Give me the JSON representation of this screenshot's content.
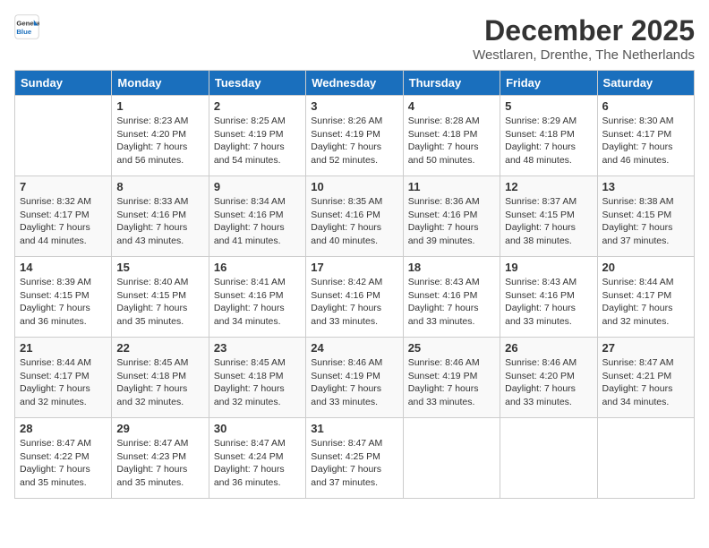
{
  "logo": {
    "general": "General",
    "blue": "Blue"
  },
  "header": {
    "month": "December 2025",
    "location": "Westlaren, Drenthe, The Netherlands"
  },
  "days_of_week": [
    "Sunday",
    "Monday",
    "Tuesday",
    "Wednesday",
    "Thursday",
    "Friday",
    "Saturday"
  ],
  "weeks": [
    [
      {
        "day": "",
        "sunrise": "",
        "sunset": "",
        "daylight": ""
      },
      {
        "day": "1",
        "sunrise": "Sunrise: 8:23 AM",
        "sunset": "Sunset: 4:20 PM",
        "daylight": "Daylight: 7 hours and 56 minutes."
      },
      {
        "day": "2",
        "sunrise": "Sunrise: 8:25 AM",
        "sunset": "Sunset: 4:19 PM",
        "daylight": "Daylight: 7 hours and 54 minutes."
      },
      {
        "day": "3",
        "sunrise": "Sunrise: 8:26 AM",
        "sunset": "Sunset: 4:19 PM",
        "daylight": "Daylight: 7 hours and 52 minutes."
      },
      {
        "day": "4",
        "sunrise": "Sunrise: 8:28 AM",
        "sunset": "Sunset: 4:18 PM",
        "daylight": "Daylight: 7 hours and 50 minutes."
      },
      {
        "day": "5",
        "sunrise": "Sunrise: 8:29 AM",
        "sunset": "Sunset: 4:18 PM",
        "daylight": "Daylight: 7 hours and 48 minutes."
      },
      {
        "day": "6",
        "sunrise": "Sunrise: 8:30 AM",
        "sunset": "Sunset: 4:17 PM",
        "daylight": "Daylight: 7 hours and 46 minutes."
      }
    ],
    [
      {
        "day": "7",
        "sunrise": "Sunrise: 8:32 AM",
        "sunset": "Sunset: 4:17 PM",
        "daylight": "Daylight: 7 hours and 44 minutes."
      },
      {
        "day": "8",
        "sunrise": "Sunrise: 8:33 AM",
        "sunset": "Sunset: 4:16 PM",
        "daylight": "Daylight: 7 hours and 43 minutes."
      },
      {
        "day": "9",
        "sunrise": "Sunrise: 8:34 AM",
        "sunset": "Sunset: 4:16 PM",
        "daylight": "Daylight: 7 hours and 41 minutes."
      },
      {
        "day": "10",
        "sunrise": "Sunrise: 8:35 AM",
        "sunset": "Sunset: 4:16 PM",
        "daylight": "Daylight: 7 hours and 40 minutes."
      },
      {
        "day": "11",
        "sunrise": "Sunrise: 8:36 AM",
        "sunset": "Sunset: 4:16 PM",
        "daylight": "Daylight: 7 hours and 39 minutes."
      },
      {
        "day": "12",
        "sunrise": "Sunrise: 8:37 AM",
        "sunset": "Sunset: 4:15 PM",
        "daylight": "Daylight: 7 hours and 38 minutes."
      },
      {
        "day": "13",
        "sunrise": "Sunrise: 8:38 AM",
        "sunset": "Sunset: 4:15 PM",
        "daylight": "Daylight: 7 hours and 37 minutes."
      }
    ],
    [
      {
        "day": "14",
        "sunrise": "Sunrise: 8:39 AM",
        "sunset": "Sunset: 4:15 PM",
        "daylight": "Daylight: 7 hours and 36 minutes."
      },
      {
        "day": "15",
        "sunrise": "Sunrise: 8:40 AM",
        "sunset": "Sunset: 4:15 PM",
        "daylight": "Daylight: 7 hours and 35 minutes."
      },
      {
        "day": "16",
        "sunrise": "Sunrise: 8:41 AM",
        "sunset": "Sunset: 4:16 PM",
        "daylight": "Daylight: 7 hours and 34 minutes."
      },
      {
        "day": "17",
        "sunrise": "Sunrise: 8:42 AM",
        "sunset": "Sunset: 4:16 PM",
        "daylight": "Daylight: 7 hours and 33 minutes."
      },
      {
        "day": "18",
        "sunrise": "Sunrise: 8:43 AM",
        "sunset": "Sunset: 4:16 PM",
        "daylight": "Daylight: 7 hours and 33 minutes."
      },
      {
        "day": "19",
        "sunrise": "Sunrise: 8:43 AM",
        "sunset": "Sunset: 4:16 PM",
        "daylight": "Daylight: 7 hours and 33 minutes."
      },
      {
        "day": "20",
        "sunrise": "Sunrise: 8:44 AM",
        "sunset": "Sunset: 4:17 PM",
        "daylight": "Daylight: 7 hours and 32 minutes."
      }
    ],
    [
      {
        "day": "21",
        "sunrise": "Sunrise: 8:44 AM",
        "sunset": "Sunset: 4:17 PM",
        "daylight": "Daylight: 7 hours and 32 minutes."
      },
      {
        "day": "22",
        "sunrise": "Sunrise: 8:45 AM",
        "sunset": "Sunset: 4:18 PM",
        "daylight": "Daylight: 7 hours and 32 minutes."
      },
      {
        "day": "23",
        "sunrise": "Sunrise: 8:45 AM",
        "sunset": "Sunset: 4:18 PM",
        "daylight": "Daylight: 7 hours and 32 minutes."
      },
      {
        "day": "24",
        "sunrise": "Sunrise: 8:46 AM",
        "sunset": "Sunset: 4:19 PM",
        "daylight": "Daylight: 7 hours and 33 minutes."
      },
      {
        "day": "25",
        "sunrise": "Sunrise: 8:46 AM",
        "sunset": "Sunset: 4:19 PM",
        "daylight": "Daylight: 7 hours and 33 minutes."
      },
      {
        "day": "26",
        "sunrise": "Sunrise: 8:46 AM",
        "sunset": "Sunset: 4:20 PM",
        "daylight": "Daylight: 7 hours and 33 minutes."
      },
      {
        "day": "27",
        "sunrise": "Sunrise: 8:47 AM",
        "sunset": "Sunset: 4:21 PM",
        "daylight": "Daylight: 7 hours and 34 minutes."
      }
    ],
    [
      {
        "day": "28",
        "sunrise": "Sunrise: 8:47 AM",
        "sunset": "Sunset: 4:22 PM",
        "daylight": "Daylight: 7 hours and 35 minutes."
      },
      {
        "day": "29",
        "sunrise": "Sunrise: 8:47 AM",
        "sunset": "Sunset: 4:23 PM",
        "daylight": "Daylight: 7 hours and 35 minutes."
      },
      {
        "day": "30",
        "sunrise": "Sunrise: 8:47 AM",
        "sunset": "Sunset: 4:24 PM",
        "daylight": "Daylight: 7 hours and 36 minutes."
      },
      {
        "day": "31",
        "sunrise": "Sunrise: 8:47 AM",
        "sunset": "Sunset: 4:25 PM",
        "daylight": "Daylight: 7 hours and 37 minutes."
      },
      {
        "day": "",
        "sunrise": "",
        "sunset": "",
        "daylight": ""
      },
      {
        "day": "",
        "sunrise": "",
        "sunset": "",
        "daylight": ""
      },
      {
        "day": "",
        "sunrise": "",
        "sunset": "",
        "daylight": ""
      }
    ]
  ]
}
